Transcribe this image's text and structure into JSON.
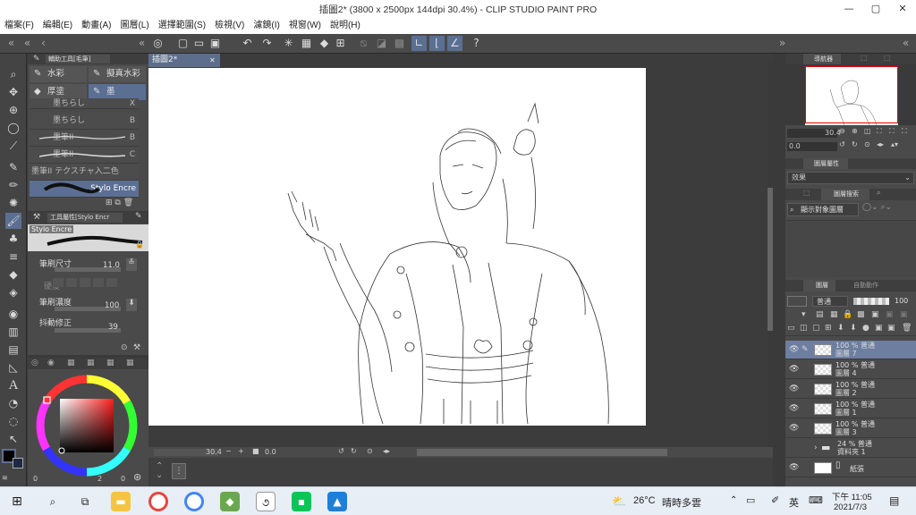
{
  "window": {
    "title": "插圖2* (3800 x 2500px 144dpi 30.4%) - CLIP STUDIO PAINT PRO",
    "minimize": "—",
    "maximize": "▢",
    "close": "✕"
  },
  "menu": [
    "檔案(F)",
    "編輯(E)",
    "動畫(A)",
    "圖層(L)",
    "選擇範圍(S)",
    "檢視(V)",
    "濾鏡(I)",
    "視窗(W)",
    "說明(H)"
  ],
  "subtool_panel": {
    "header": "輔助工具[毛筆]",
    "tabs": [
      "水彩",
      "擬真水彩",
      "厚塗",
      "墨"
    ],
    "selected_tab": "墨",
    "brushes": [
      {
        "name": "墨ちらし",
        "num": "X"
      },
      {
        "name": "墨ちらし",
        "num": "B"
      },
      {
        "name": "墨筆II",
        "num": "B"
      },
      {
        "name": "墨筆II",
        "num": "C"
      },
      {
        "name": "墨筆II テクスチャ入二色",
        "num": ""
      },
      {
        "name": "Stylo Encre",
        "num": ""
      }
    ]
  },
  "tool_property": {
    "header": "工具屬性[Stylo Encr",
    "brush_name": "Stylo Encre",
    "brush_size_label": "筆刷尺寸",
    "brush_size_value": "11.0",
    "hardness_label": "硬度",
    "density_label": "筆刷濃度",
    "density_value": "100",
    "stabilization_label": "抖動修正",
    "stabilization_value": "39"
  },
  "color": {
    "main_color": "#000000",
    "sub_color": "#1e2a44",
    "value_a": "0",
    "value_b": "2",
    "value_c": "0"
  },
  "canvas": {
    "tab_label": "插圖2*",
    "zoom": "30.4",
    "rotation": "0.0"
  },
  "navigator": {
    "header": "導航器",
    "zoom": "30.4",
    "rotation": "0.0"
  },
  "layer_property": {
    "header": "圖層屬性",
    "effect_label": "效果"
  },
  "layer_search": {
    "header": "圖層搜索",
    "filter_label": "顯示對象圖層"
  },
  "layer_panel": {
    "header": "圖層",
    "header2": "自動動作",
    "blend_mode": "普通",
    "opacity": "100",
    "layers": [
      {
        "line1": "100 % 普通",
        "line2": "圖層 7",
        "selected": true
      },
      {
        "line1": "100 % 普通",
        "line2": "圖層 4",
        "selected": false
      },
      {
        "line1": "100 % 普通",
        "line2": "圖層 2",
        "selected": false
      },
      {
        "line1": "100 % 普通",
        "line2": "圖層 1",
        "selected": false
      },
      {
        "line1": "100 % 普通",
        "line2": "圖層 3",
        "selected": false
      },
      {
        "line1": "24 % 普通",
        "line2": "資料夾 1",
        "selected": false
      },
      {
        "line1": "",
        "line2": "紙張",
        "selected": false
      }
    ]
  },
  "taskbar": {
    "weather_temp": "26°C",
    "weather_text": "晴時多雲",
    "ime": "英",
    "time": "下午 11:05",
    "date": "2021/7/3"
  },
  "colors": {
    "accent": "#5b6f93",
    "panel": "#4a4a4a",
    "dark": "#3a3a3a"
  }
}
